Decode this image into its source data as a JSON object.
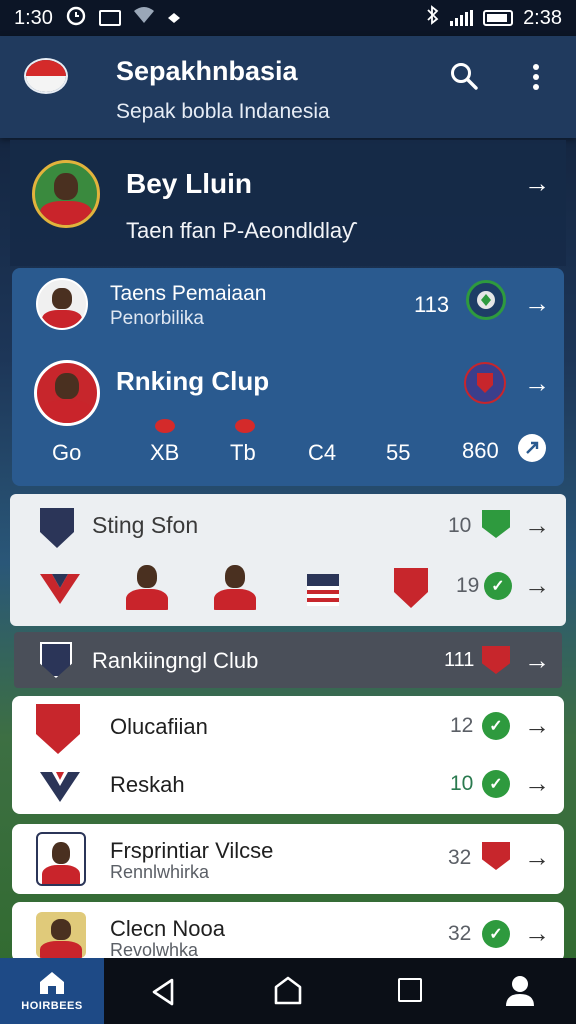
{
  "status_bar": {
    "time": "1:30",
    "time_right": "2:38"
  },
  "app_bar": {
    "title": "Sepakhnbasia",
    "subtitle": "Sepak bobla Indanesia",
    "flag_colors": [
      "#d42a2a",
      "#f4f4f4"
    ],
    "search_icon": "search-icon",
    "menu_icon": "more-vert-icon"
  },
  "profile": {
    "name": "Bey Lluin",
    "subtitle": "Taen ffan P-Aeondldlaƴ"
  },
  "blue_panel": {
    "row1": {
      "title": "Taens Pemaiaan",
      "subtitle": "Penorbilika",
      "value": "113"
    },
    "row2": {
      "title": "Rnking Clup"
    },
    "stats": [
      "Go",
      "XB",
      "Tb",
      "C4",
      "55",
      "860"
    ]
  },
  "light_panel": {
    "title": "Sting Sfon",
    "value1": "10",
    "value2": "19"
  },
  "dark_bar": {
    "title": "Rankiingngl Club",
    "value": "111"
  },
  "list_card": {
    "items": [
      {
        "title": "Olucafiian",
        "value": "12"
      },
      {
        "title": "Reskah",
        "value": "10"
      }
    ]
  },
  "card2": {
    "title": "Frsprintiar Vilcse",
    "subtitle": "Rennlwhirka",
    "value": "32"
  },
  "card3": {
    "title": "Clecn Nooa",
    "subtitle": "Revolwhka",
    "value": "32"
  },
  "bottom_nav": {
    "home_label": "HOIRBEES"
  },
  "colors": {
    "accent_blue": "#2a5a8f",
    "appbar": "#203a5e",
    "badge_green": "#2e9a3e",
    "badge_red": "#c7262c"
  }
}
